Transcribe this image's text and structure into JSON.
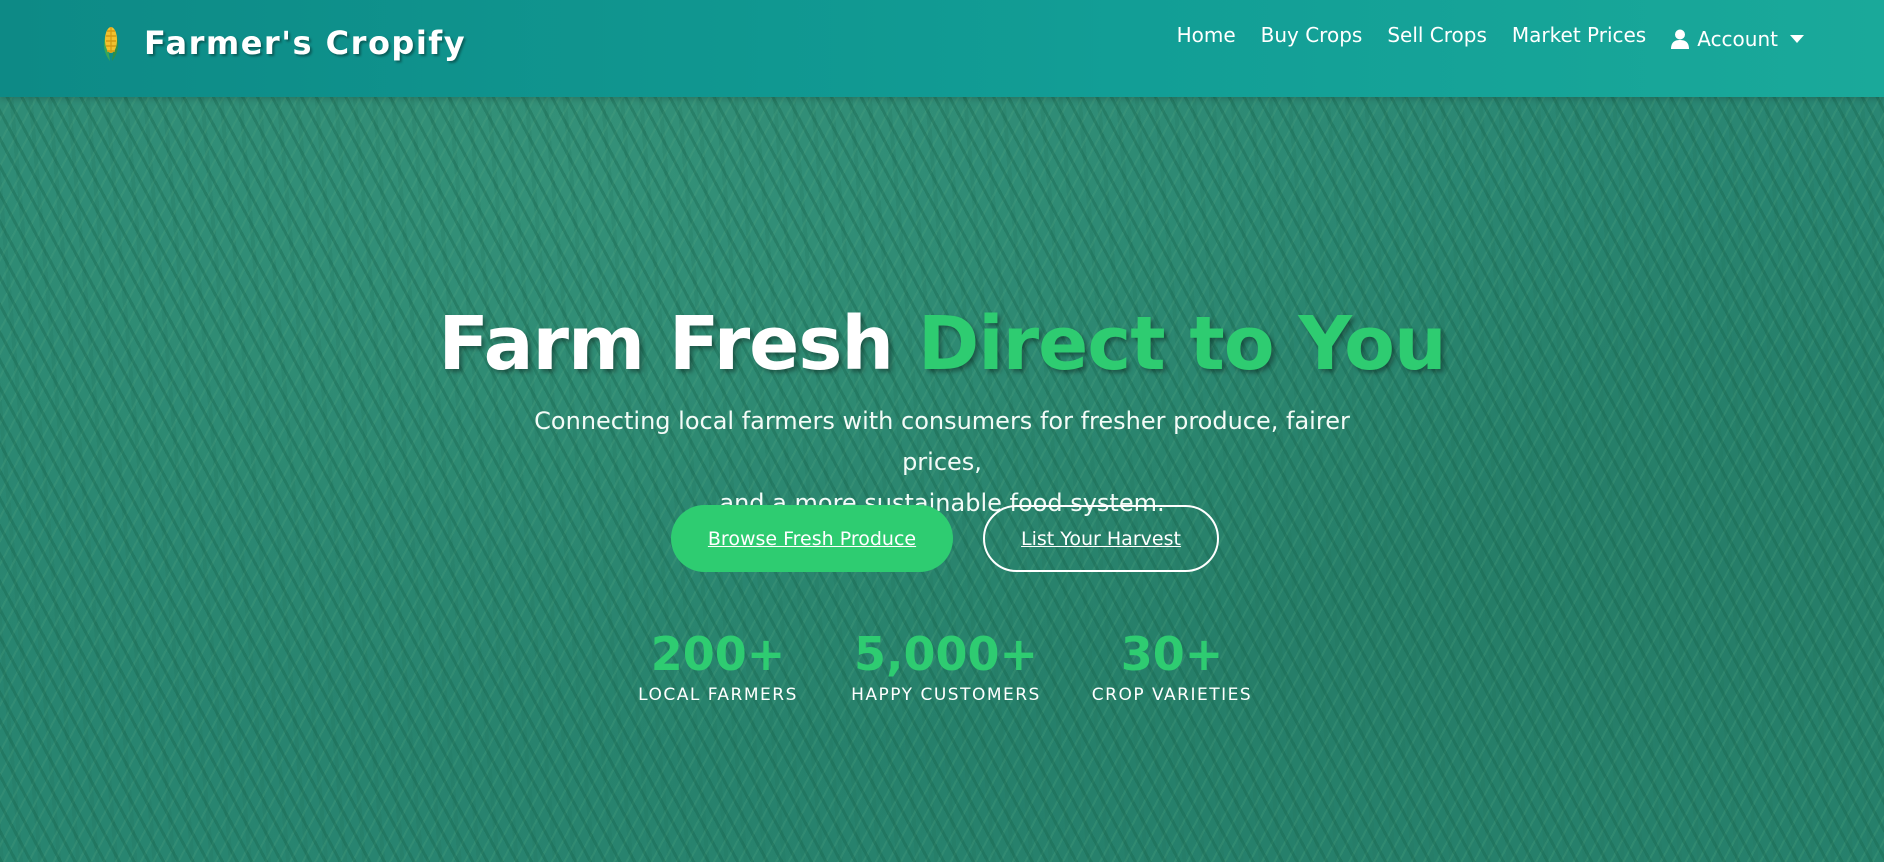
{
  "brand": {
    "name": "Farmer's Cropify",
    "logo_icon": "corn-logo-icon"
  },
  "nav": {
    "links": [
      "Home",
      "Buy Crops",
      "Sell Crops",
      "Market Prices"
    ],
    "account_label": "Account",
    "account_icon": "user-icon",
    "account_caret_icon": "caret-down-icon"
  },
  "hero": {
    "headline_white": "Farm Fresh",
    "headline_green": "Direct to You",
    "subtitle_line1": "Connecting local farmers with consumers for fresher produce, fairer prices,",
    "subtitle_line2": "and a more sustainable food system.",
    "primary_button": "Browse Fresh Produce",
    "secondary_button": "List Your Harvest"
  },
  "stats": [
    {
      "value": "200+",
      "label": "LOCAL FARMERS"
    },
    {
      "value": "5,000+",
      "label": "HAPPY CUSTOMERS"
    },
    {
      "value": "30+",
      "label": "CROP VARIETIES"
    }
  ],
  "colors": {
    "navbar": "#129e96",
    "accent_green": "#2ecc71",
    "hero_overlay": "#2f8a70"
  }
}
